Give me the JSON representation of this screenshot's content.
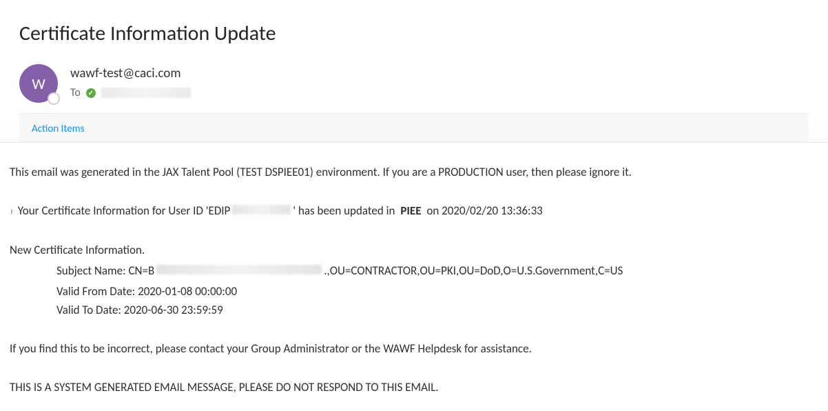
{
  "subject": "Certificate Information Update",
  "avatarInitial": "W",
  "senderEmail": "wawf-test@caci.com",
  "toLabel": "To",
  "actionItemsLabel": "Action Items",
  "body": {
    "envNotice": "This email was generated in the JAX Talent Pool (TEST DSPIEE01) environment. If you are a PRODUCTION user, then please ignore it.",
    "certLine": {
      "prefix": "Your Certificate Information for User ID 'EDIP",
      "afterPrefix": "' has been updated in",
      "system": "PIEE",
      "timestamp": "on 2020/02/20 13:36:33"
    },
    "newCertTitle": "New Certificate Information.",
    "subjectName": {
      "label": "Subject Name: CN=B",
      "suffix": ".,OU=CONTRACTOR,OU=PKI,OU=DoD,O=U.S.Government,C=US"
    },
    "validFrom": "Valid From Date: 2020-01-08 00:00:00",
    "validTo": "Valid To Date: 2020-06-30 23:59:59",
    "incorrectNotice": "If you find this to be incorrect, please contact your Group Administrator or the WAWF Helpdesk for assistance.",
    "systemNotice": "THIS IS A SYSTEM GENERATED EMAIL MESSAGE, PLEASE DO NOT RESPOND TO THIS EMAIL."
  }
}
